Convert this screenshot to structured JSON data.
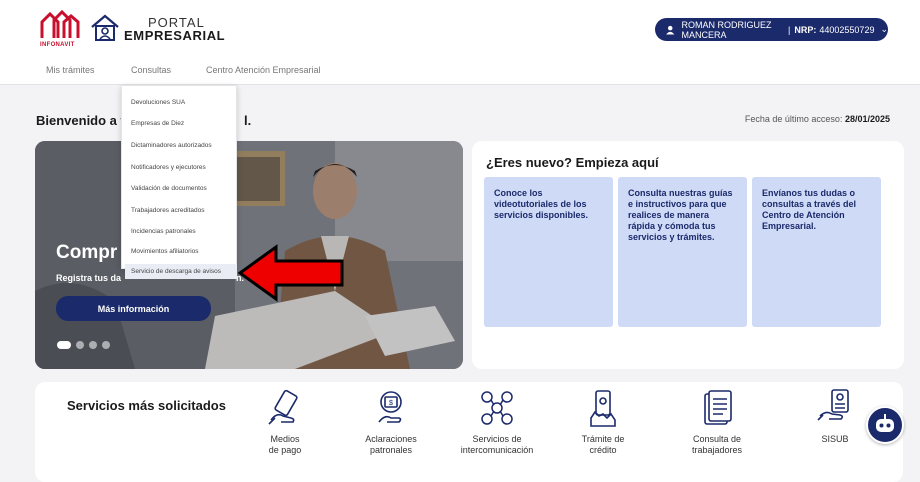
{
  "header": {
    "brand_infonavit": "INFONAVIT",
    "portal_small": "PORTAL",
    "portal_big": "EMPRESARIAL",
    "user_name": "ROMAN RODRIGUEZ MANCERA",
    "nrp_label": "NRP:",
    "nrp_value": "44002550729"
  },
  "nav": {
    "items": [
      "Mis trámites",
      "Consultas",
      "Centro Atención Empresarial"
    ]
  },
  "consultas_menu": {
    "items": [
      "Devoluciones SUA",
      "Empresas de Diez",
      "Dictaminadores autorizados",
      "Notificadores y ejecutores",
      "Validación de documentos",
      "Trabajadores acreditados",
      "Incidencias patronales",
      "Movimientos afiliatorios",
      "Servicio de descarga de avisos"
    ],
    "highlighted_index": 8
  },
  "welcome": {
    "start": "Bienvenido a t",
    "end": "l.",
    "last_access_label": "Fecha de último acceso:",
    "last_access_date": "28/01/2025"
  },
  "hero": {
    "title": "Compr",
    "subtitle_start": "Registra tus da",
    "subtitle_end": "n.",
    "button": "Más información",
    "slide_count": 4,
    "active_slide": 1
  },
  "new_user": {
    "title": "¿Eres nuevo? Empieza aquí",
    "tips": [
      "Conoce los videotutoriales de los servicios disponibles.",
      "Consulta nuestras guías e instructivos para que realices de manera rápida y cómoda tus servicios y trámites.",
      "Envíanos tus dudas o consultas a través del Centro de Atención Empresarial."
    ]
  },
  "services": {
    "title": "Servicios más solicitados",
    "items": [
      {
        "line1": "Medios",
        "line2": "de pago",
        "icon": "payment-card-hand-icon"
      },
      {
        "line1": "Aclaraciones",
        "line2": "patronales",
        "icon": "money-hand-icon"
      },
      {
        "line1": "Servicios de",
        "line2": "intercomunicación",
        "icon": "network-people-icon"
      },
      {
        "line1": "Trámite de",
        "line2": "crédito",
        "icon": "phone-hand-icon"
      },
      {
        "line1": "Consulta de",
        "line2": "trabajadores",
        "icon": "document-list-icon"
      },
      {
        "line1": "SISUB",
        "line2": "",
        "icon": "id-hand-icon"
      }
    ]
  },
  "colors": {
    "primary": "#1b2a6b",
    "tip_background": "#cfdaf7",
    "brand_red": "#c8102e",
    "arrow_red": "#ee0000"
  }
}
